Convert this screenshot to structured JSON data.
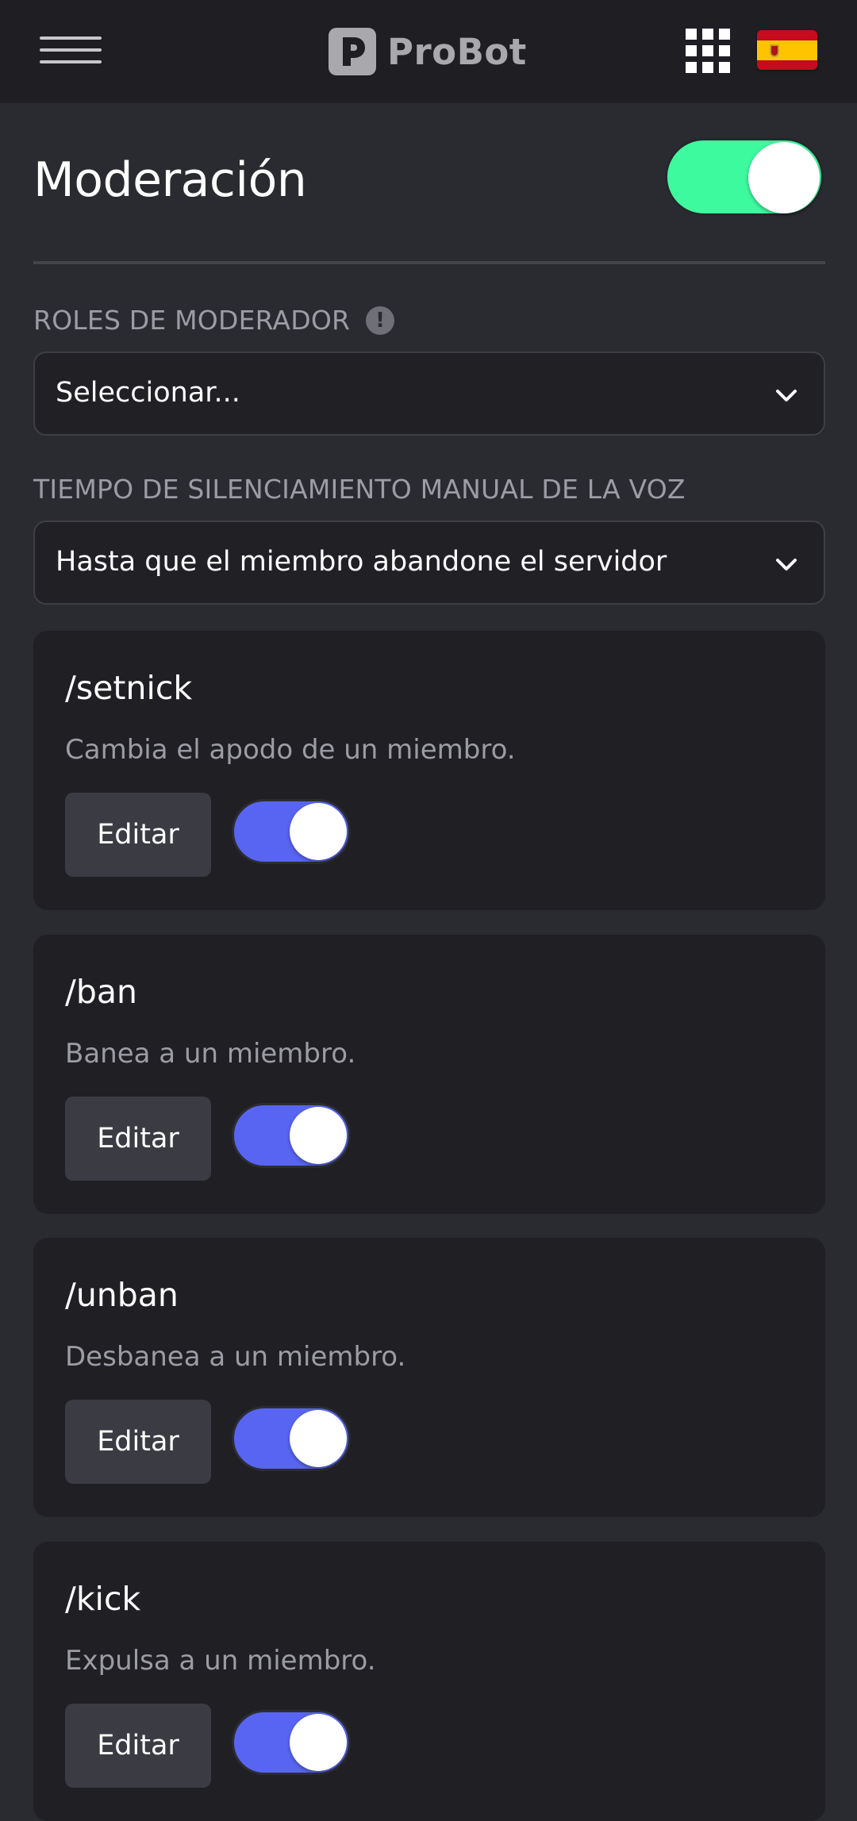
{
  "header": {
    "menu_icon": "hamburger-menu-icon",
    "brand_name": "ProBot",
    "brand_icon": "probot-logo-icon",
    "apps_icon": "apps-grid-icon",
    "language_flag": "spain-flag-icon"
  },
  "section": {
    "title": "Moderación",
    "enabled": true,
    "toggle_color": "#3dfa9e"
  },
  "fields": {
    "moderator_roles": {
      "label": "ROLES DE MODERADOR",
      "info_icon": "info-icon",
      "info_glyph": "!",
      "placeholder": "Seleccionar..."
    },
    "voice_mute_time": {
      "label": "TIEMPO DE SILENCIAMIENTO MANUAL DE LA VOZ",
      "value": "Hasta que el miembro abandone el servidor"
    }
  },
  "commands": [
    {
      "name": "/setnick",
      "description": "Cambia el apodo de un miembro.",
      "edit_label": "Editar",
      "enabled": true
    },
    {
      "name": "/ban",
      "description": "Banea a un miembro.",
      "edit_label": "Editar",
      "enabled": true
    },
    {
      "name": "/unban",
      "description": "Desbanea a un miembro.",
      "edit_label": "Editar",
      "enabled": true
    },
    {
      "name": "/kick",
      "description": "Expulsa a un miembro.",
      "edit_label": "Editar",
      "enabled": true
    }
  ],
  "colors": {
    "command_toggle": "#5865f2",
    "background": "#2a2b30",
    "card": "#1f1f24"
  }
}
